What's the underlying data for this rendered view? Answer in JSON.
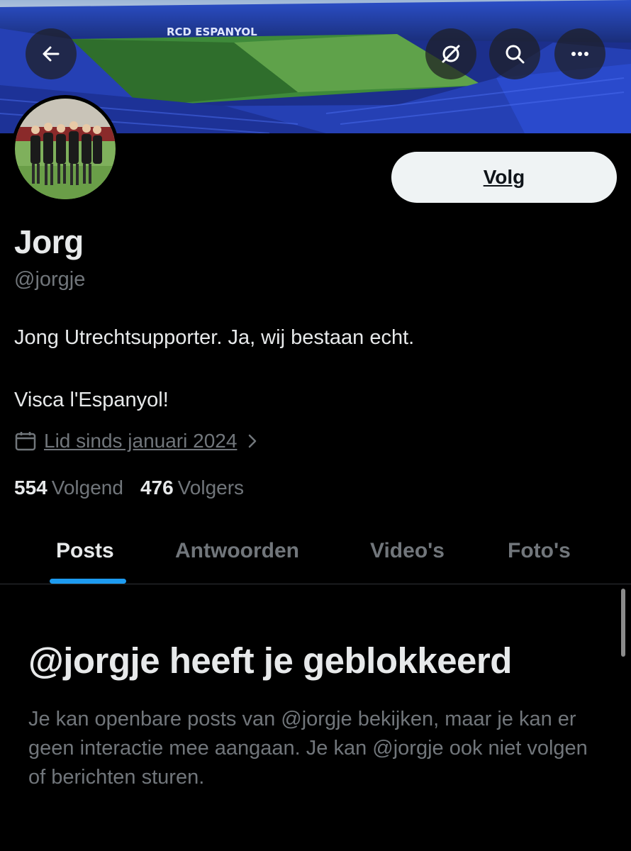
{
  "header": {
    "back_icon": "arrow-left-icon",
    "grok_icon": "grok-slash-circle-icon",
    "search_icon": "search-icon",
    "more_icon": "more-dots-icon",
    "banner_text": "RCD ESPANYOL"
  },
  "profile": {
    "name": "Jorg",
    "handle": "@jorgje",
    "bio_line1": "Jong Utrechtsupporter. Ja, wij bestaan echt.",
    "bio_line2": "Visca l'Espanyol!",
    "joined": "Lid sinds januari 2024",
    "following_count": "554",
    "following_label": "Volgend",
    "followers_count": "476",
    "followers_label": "Volgers",
    "follow_button": "Volg"
  },
  "tabs": [
    {
      "label": "Posts",
      "active": true
    },
    {
      "label": "Antwoorden",
      "active": false
    },
    {
      "label": "Video's",
      "active": false
    },
    {
      "label": "Foto's",
      "active": false
    }
  ],
  "blocked": {
    "title": "@jorgje heeft je geblokkeerd",
    "description": "Je kan openbare posts van @jorgje bekijken, maar je kan er geen interactie mee aangaan. Je kan @jorgje ook niet volgen of berichten sturen."
  },
  "colors": {
    "background": "#000000",
    "text_primary": "#e7e9ea",
    "text_secondary": "#71767b",
    "accent": "#1d9bf0",
    "button_bg": "#eff3f4"
  }
}
